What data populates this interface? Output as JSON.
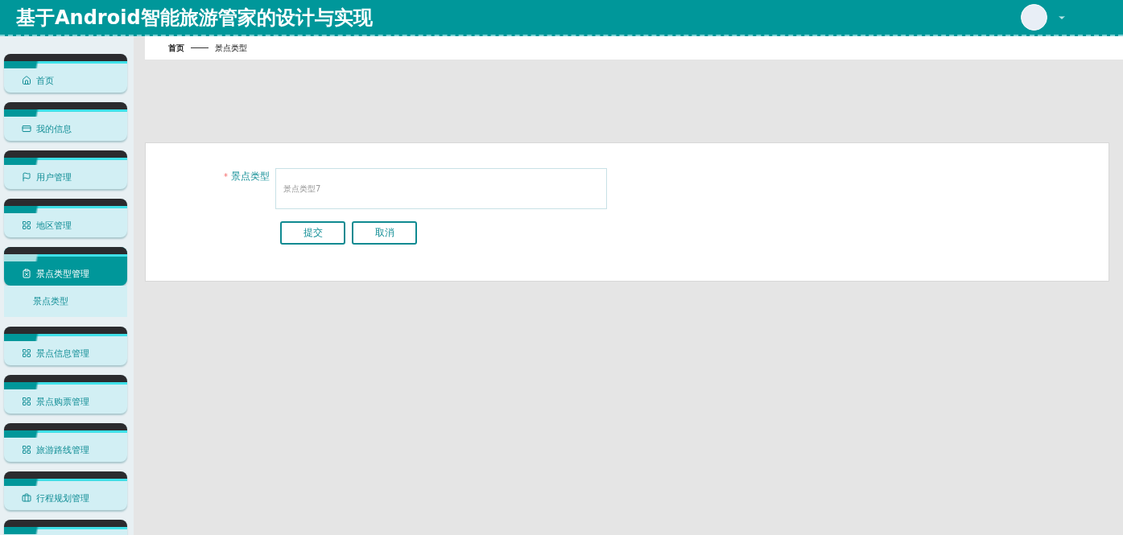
{
  "header": {
    "title": "基于Android智能旅游管家的设计与实现"
  },
  "sidebar": {
    "items": [
      {
        "label": "首页",
        "selected": false
      },
      {
        "label": "我的信息",
        "selected": false
      },
      {
        "label": "用户管理",
        "selected": false
      },
      {
        "label": "地区管理",
        "selected": false
      },
      {
        "label": "景点类型管理",
        "selected": true,
        "expanded": true,
        "children": [
          {
            "label": "景点类型",
            "selected": false
          }
        ]
      },
      {
        "label": "景点信息管理",
        "selected": false
      },
      {
        "label": "景点购票管理",
        "selected": false
      },
      {
        "label": "旅游路线管理",
        "selected": false
      },
      {
        "label": "行程规划管理",
        "selected": false
      }
    ]
  },
  "breadcrumb": [
    "首页",
    "景点类型"
  ],
  "form": {
    "field": {
      "label": "景点类型",
      "required_mark": "*",
      "value": "景点类型7"
    },
    "buttons": [
      "提交",
      "取消"
    ]
  }
}
